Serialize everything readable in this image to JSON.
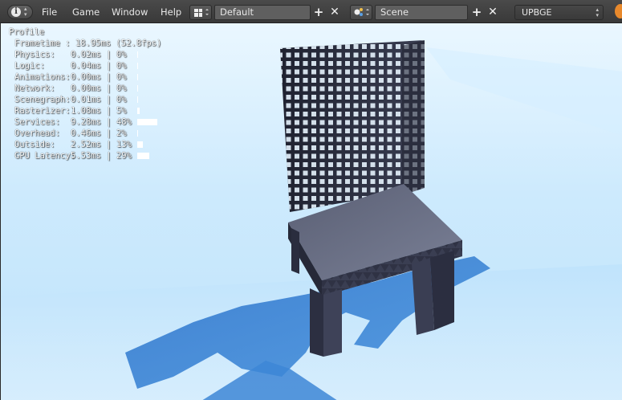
{
  "topbar": {
    "menus": [
      "File",
      "Game",
      "Window",
      "Help"
    ],
    "screen_layout": "Default",
    "scene": "Scene",
    "engine": "UPBGE"
  },
  "profile": {
    "title": "Profile",
    "frametime": "Frametime : 18.95ms (52.8fps)",
    "rows": [
      {
        "label": "Physics:",
        "value": "0.02ms",
        "percent": "0%",
        "fraction": 0.0
      },
      {
        "label": "Logic:",
        "value": "0.04ms",
        "percent": "0%",
        "fraction": 0.0
      },
      {
        "label": "Animations:",
        "value": "0.00ms",
        "percent": "0%",
        "fraction": 0.0
      },
      {
        "label": "Network:",
        "value": "0.00ms",
        "percent": "0%",
        "fraction": 0.0
      },
      {
        "label": "Scenegraph:",
        "value": "0.01ms",
        "percent": "0%",
        "fraction": 0.0
      },
      {
        "label": "Rasterizer:",
        "value": "1.08ms",
        "percent": "5%",
        "fraction": 0.05
      },
      {
        "label": "Services:",
        "value": "9.28ms",
        "percent": "48%",
        "fraction": 0.48
      },
      {
        "label": "Overhead:",
        "value": "0.46ms",
        "percent": "2%",
        "fraction": 0.02
      },
      {
        "label": "Outside:",
        "value": "2.52ms",
        "percent": "13%",
        "fraction": 0.13
      },
      {
        "label": "GPU Latency:",
        "value": "5.53ms",
        "percent": "29%",
        "fraction": 0.29
      }
    ]
  },
  "colors": {
    "sky_top": "#e8f6ff",
    "sky_bottom": "#a9d8f8",
    "shadow": "#3e87d6",
    "chair_dark": "#2a2d3e",
    "chair_mid": "#4a4f66",
    "seat_top": "#6e7488"
  }
}
